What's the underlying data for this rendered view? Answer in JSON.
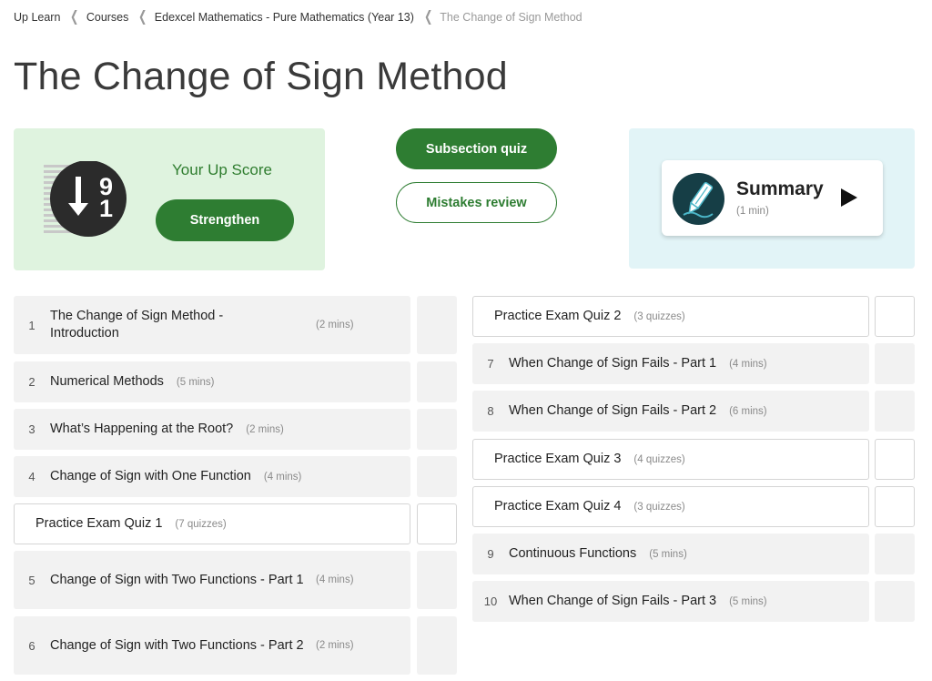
{
  "breadcrumb": [
    "Up Learn",
    "Courses",
    "Edexcel Mathematics - Pure Mathematics (Year 13)",
    "The Change of Sign Method"
  ],
  "page_title": "The Change of Sign Method",
  "score": {
    "label": "Your Up Score",
    "button": "Strengthen",
    "logo_top": "9",
    "logo_bottom": "1",
    "logo_arrow": "down-arrow-icon"
  },
  "buttons": {
    "subsection_quiz": "Subsection quiz",
    "mistakes_review": "Mistakes review"
  },
  "summary": {
    "title": "Summary",
    "duration": "(1 min)",
    "icon": "pen-icon",
    "play_icon": "play-icon"
  },
  "colors": {
    "accent_green": "#2e7d32",
    "score_bg": "#dff3df",
    "summary_bg": "#e2f4f7",
    "row_bg": "#f2f2f2"
  },
  "left_lessons": [
    {
      "num": "1",
      "title": "The Change of Sign Method - Introduction",
      "duration": "(2 mins)"
    },
    {
      "num": "2",
      "title": "Numerical Methods",
      "duration": "(5 mins)"
    },
    {
      "num": "3",
      "title": "What’s Happening at the Root?",
      "duration": "(2 mins)"
    },
    {
      "num": "4",
      "title": "Change of Sign with One Function",
      "duration": "(4 mins)"
    },
    {
      "num": "",
      "title": "Practice Exam Quiz 1",
      "duration": "(7 quizzes)"
    },
    {
      "num": "5",
      "title": "Change of Sign with Two Functions - Part 1",
      "duration": "(4 mins)"
    },
    {
      "num": "6",
      "title": "Change of Sign with Two Functions - Part 2",
      "duration": "(2 mins)"
    }
  ],
  "right_lessons": [
    {
      "num": "",
      "title": "Practice Exam Quiz 2",
      "duration": "(3 quizzes)"
    },
    {
      "num": "7",
      "title": "When Change of Sign Fails - Part 1",
      "duration": "(4 mins)"
    },
    {
      "num": "8",
      "title": "When Change of Sign Fails - Part 2",
      "duration": "(6 mins)"
    },
    {
      "num": "",
      "title": "Practice Exam Quiz 3",
      "duration": "(4 quizzes)"
    },
    {
      "num": "",
      "title": "Practice Exam Quiz 4",
      "duration": "(3 quizzes)"
    },
    {
      "num": "9",
      "title": "Continuous Functions",
      "duration": "(5 mins)"
    },
    {
      "num": "10",
      "title": "When Change of Sign Fails - Part 3",
      "duration": "(5 mins)"
    }
  ]
}
